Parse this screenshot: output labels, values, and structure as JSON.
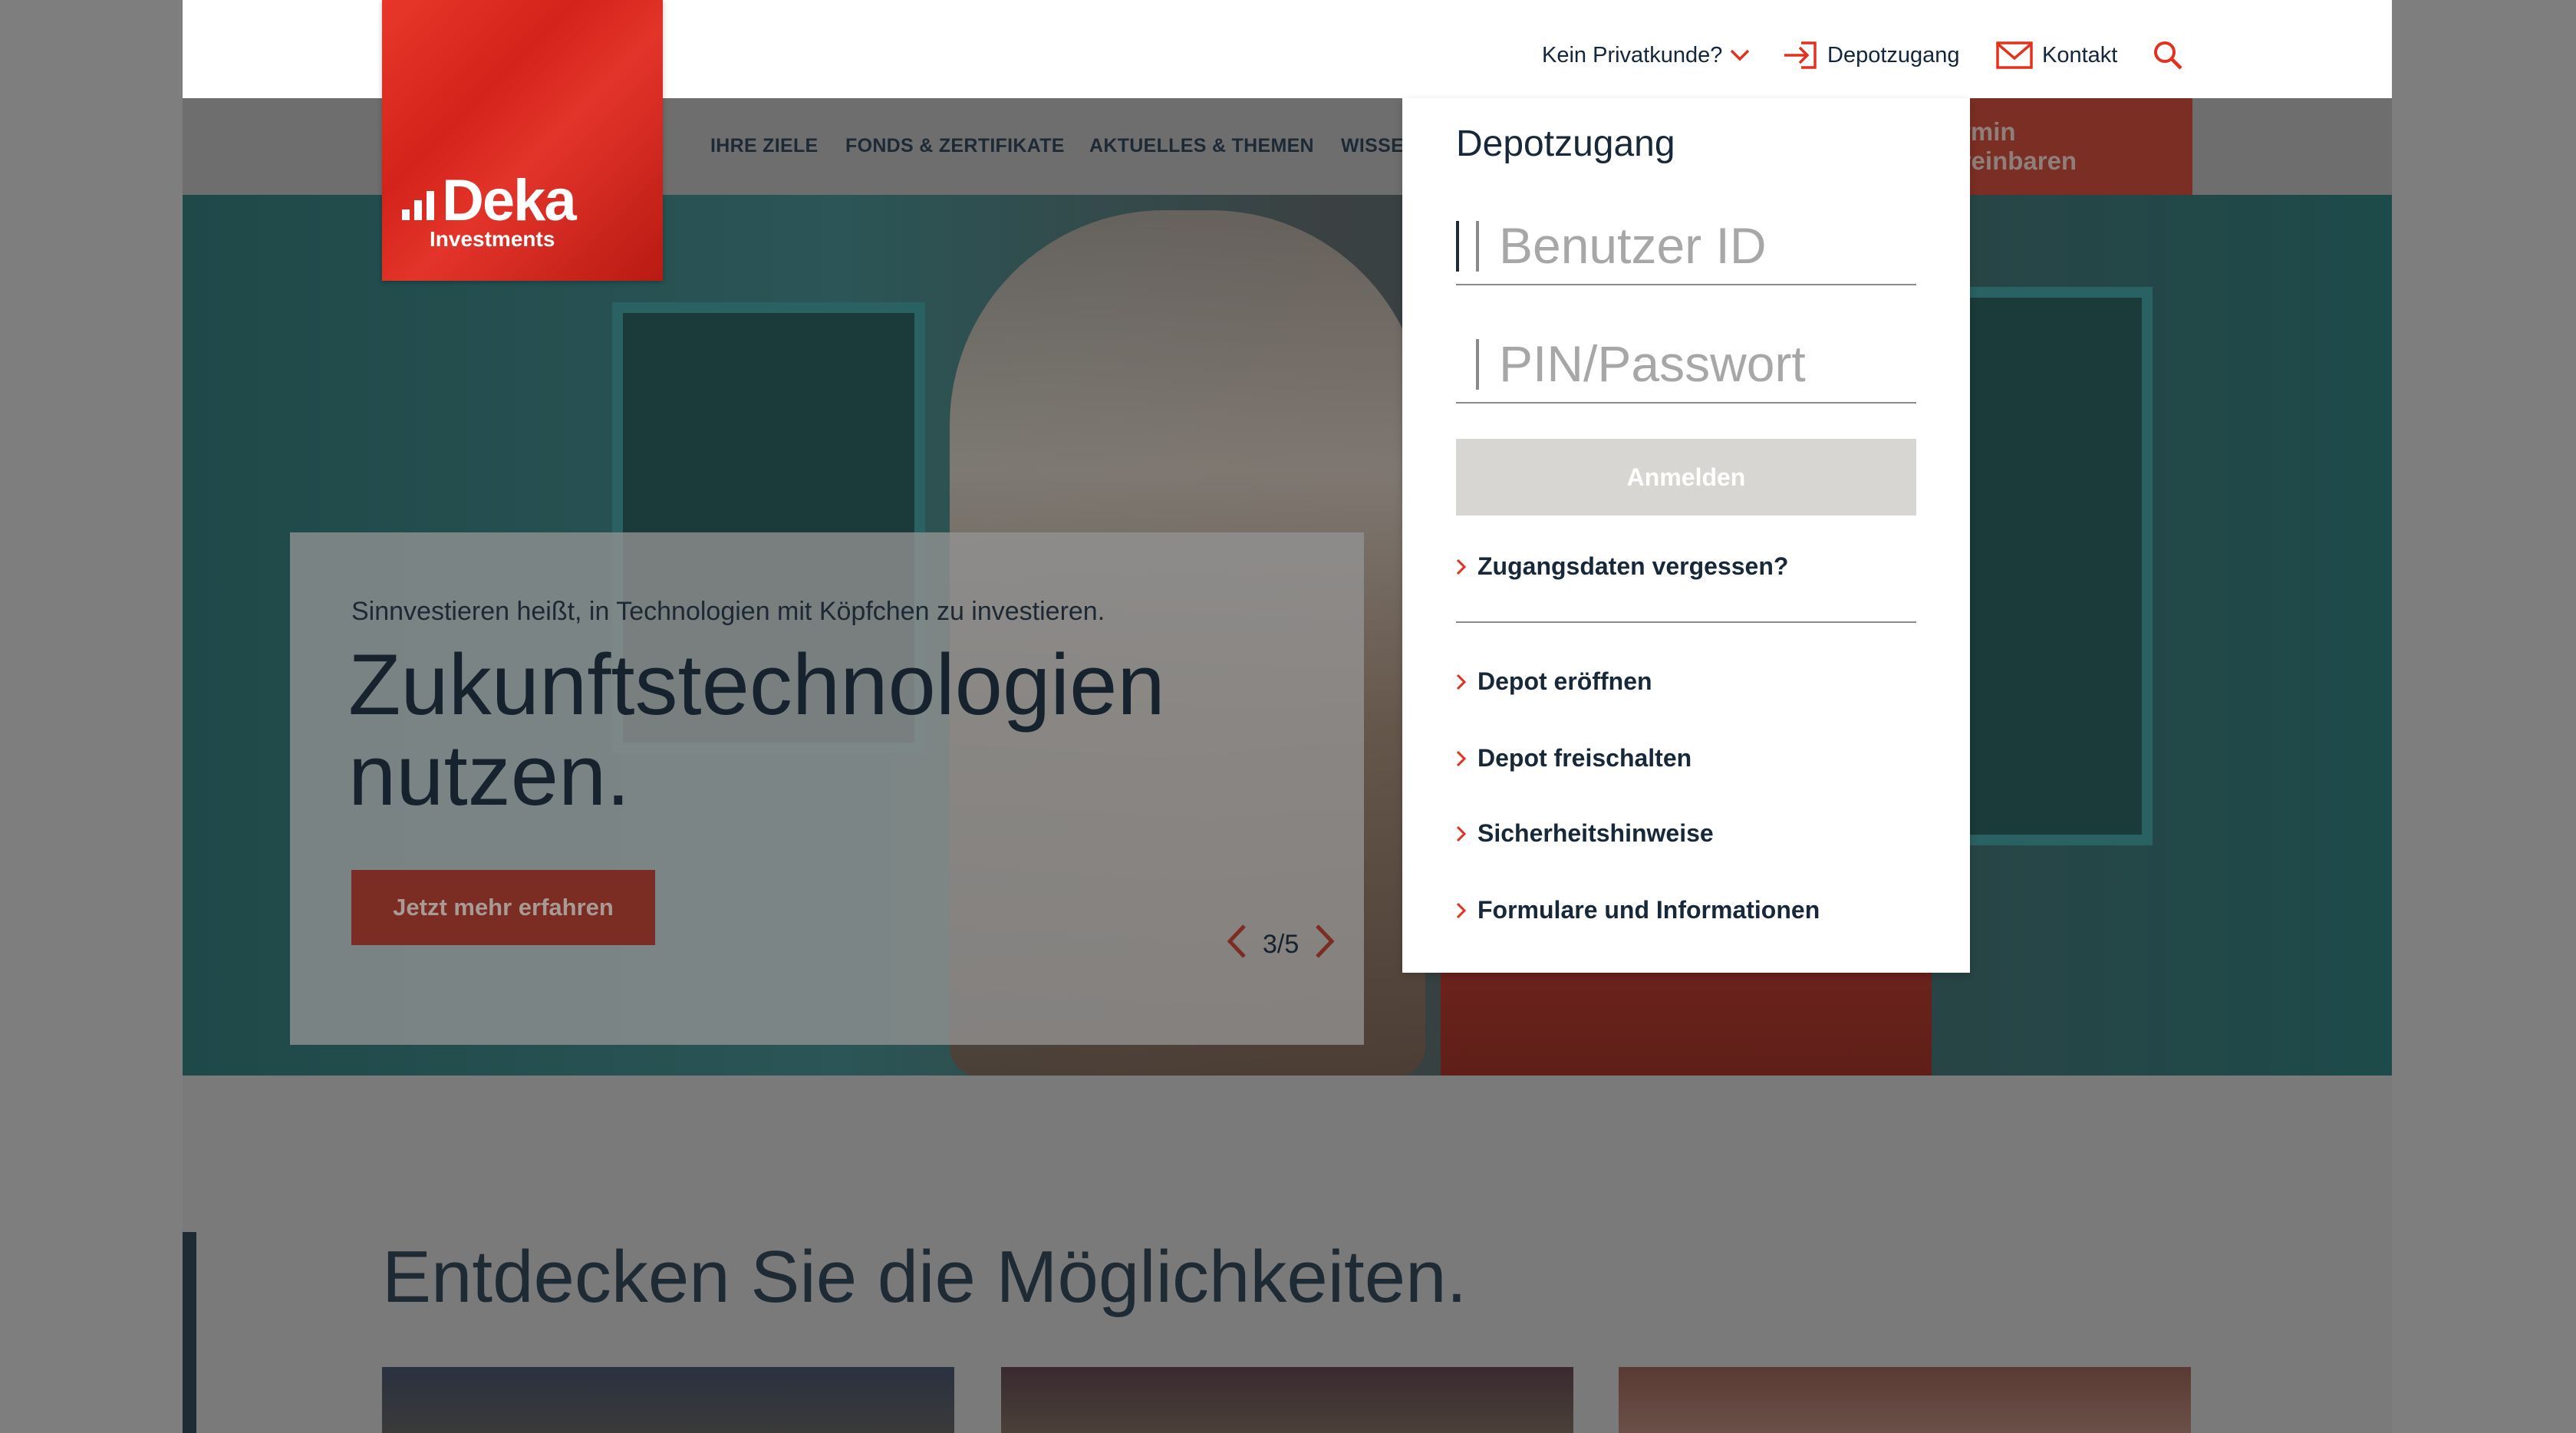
{
  "utility_nav": {
    "not_private": "Kein Privatkunde?",
    "depot": "Depotzugang",
    "contact": "Kontakt"
  },
  "logo": {
    "brand": "Deka",
    "sub": "Investments"
  },
  "main_nav": {
    "items": [
      "IHRE ZIELE",
      "FONDS & ZERTIFIKATE",
      "AKTUELLES & THEMEN",
      "WISSEN"
    ],
    "cta": "Termin vereinbaren"
  },
  "hero": {
    "kicker": "Sinnvestieren heißt, in Technologien mit Köpfchen zu investieren.",
    "headline": "Zukunftstechnologien nutzen.",
    "cta": "Jetzt mehr erfahren",
    "pager": "3/5"
  },
  "section": {
    "title": "Entdecken Sie die Möglichkeiten."
  },
  "login_panel": {
    "title": "Depotzugang",
    "user_placeholder": "Benutzer ID",
    "pin_placeholder": "PIN/Passwort",
    "login_button": "Anmelden",
    "forgot": "Zugangsdaten vergessen?",
    "links": [
      "Depot eröffnen",
      "Depot freischalten",
      "Sicherheitshinweise",
      "Formulare und Informationen"
    ]
  },
  "colors": {
    "accent_red": "#e2321f",
    "navy_text": "#17283a",
    "button_disabled": "#d8d6d2"
  },
  "icons": {
    "chevron": "chevron-down-icon",
    "login": "login-arrow-icon",
    "mail": "mail-icon",
    "search": "search-icon",
    "link": "chevron-right-icon"
  }
}
